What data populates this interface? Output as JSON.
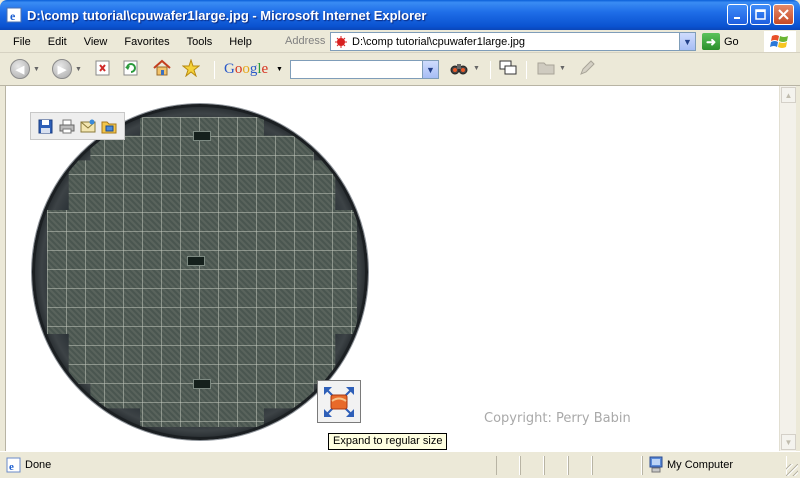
{
  "window": {
    "title": "D:\\comp tutorial\\cpuwafer1large.jpg - Microsoft Internet Explorer"
  },
  "menu": {
    "items": [
      {
        "label": "File"
      },
      {
        "label": "Edit"
      },
      {
        "label": "View"
      },
      {
        "label": "Favorites"
      },
      {
        "label": "Tools"
      },
      {
        "label": "Help"
      }
    ]
  },
  "address_bar": {
    "label": "Address",
    "value": "D:\\comp tutorial\\cpuwafer1large.jpg",
    "go_label": "Go"
  },
  "toolbar": {
    "search_value": ""
  },
  "content": {
    "tooltip": "Expand to regular size",
    "copyright": "Copyright: Perry Babin"
  },
  "status": {
    "text": "Done",
    "zone": "My Computer"
  },
  "colors": {
    "titlebar": "#0a52d0",
    "chrome": "#ece9d8",
    "tooltip_bg": "#ffffe1"
  }
}
